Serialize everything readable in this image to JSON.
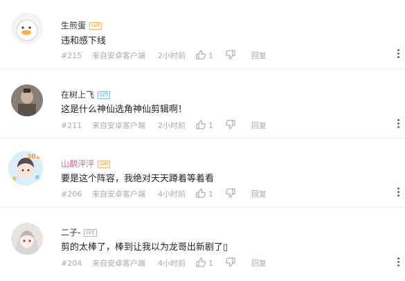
{
  "comments": [
    {
      "username": "生煎蛋",
      "level": "LV6",
      "text": "违和感下线",
      "floor": "#215",
      "source": "来自安卓客户端",
      "time": "2小时前",
      "likes": "1",
      "reply": "回复"
    },
    {
      "username": "在树上飞",
      "level": "LV5",
      "text": "这是什么神仙选角神仙剪辑啊！",
      "floor": "#211",
      "source": "来自安卓客户端",
      "time": "2小时前",
      "likes": "1",
      "reply": "回复"
    },
    {
      "username": "山鹬泙泙",
      "level": "LV6",
      "text": "要是这个阵容，我绝对天天蹲着等着看",
      "floor": "#206",
      "source": "来自安卓客户端",
      "time": "4小时前",
      "likes": "1",
      "reply": "回复"
    },
    {
      "username": "二子-",
      "level": "LV2",
      "text": "剪的太棒了，棒到让我以为龙哥出新剧了▯",
      "floor": "#204",
      "source": "来自安卓客户端",
      "time": "4小时前",
      "likes": "1",
      "reply": "回复"
    }
  ],
  "icons": {
    "like": "thumbs-up-icon",
    "dislike": "thumbs-down-icon",
    "more": "more-vertical-icon"
  },
  "colors": {
    "level_orange": "#f29b2c",
    "level_blue": "#4ba0db",
    "level_green": "#53b253",
    "vip_name": "#e05a8a",
    "meta_gray": "#aaaaaa"
  }
}
